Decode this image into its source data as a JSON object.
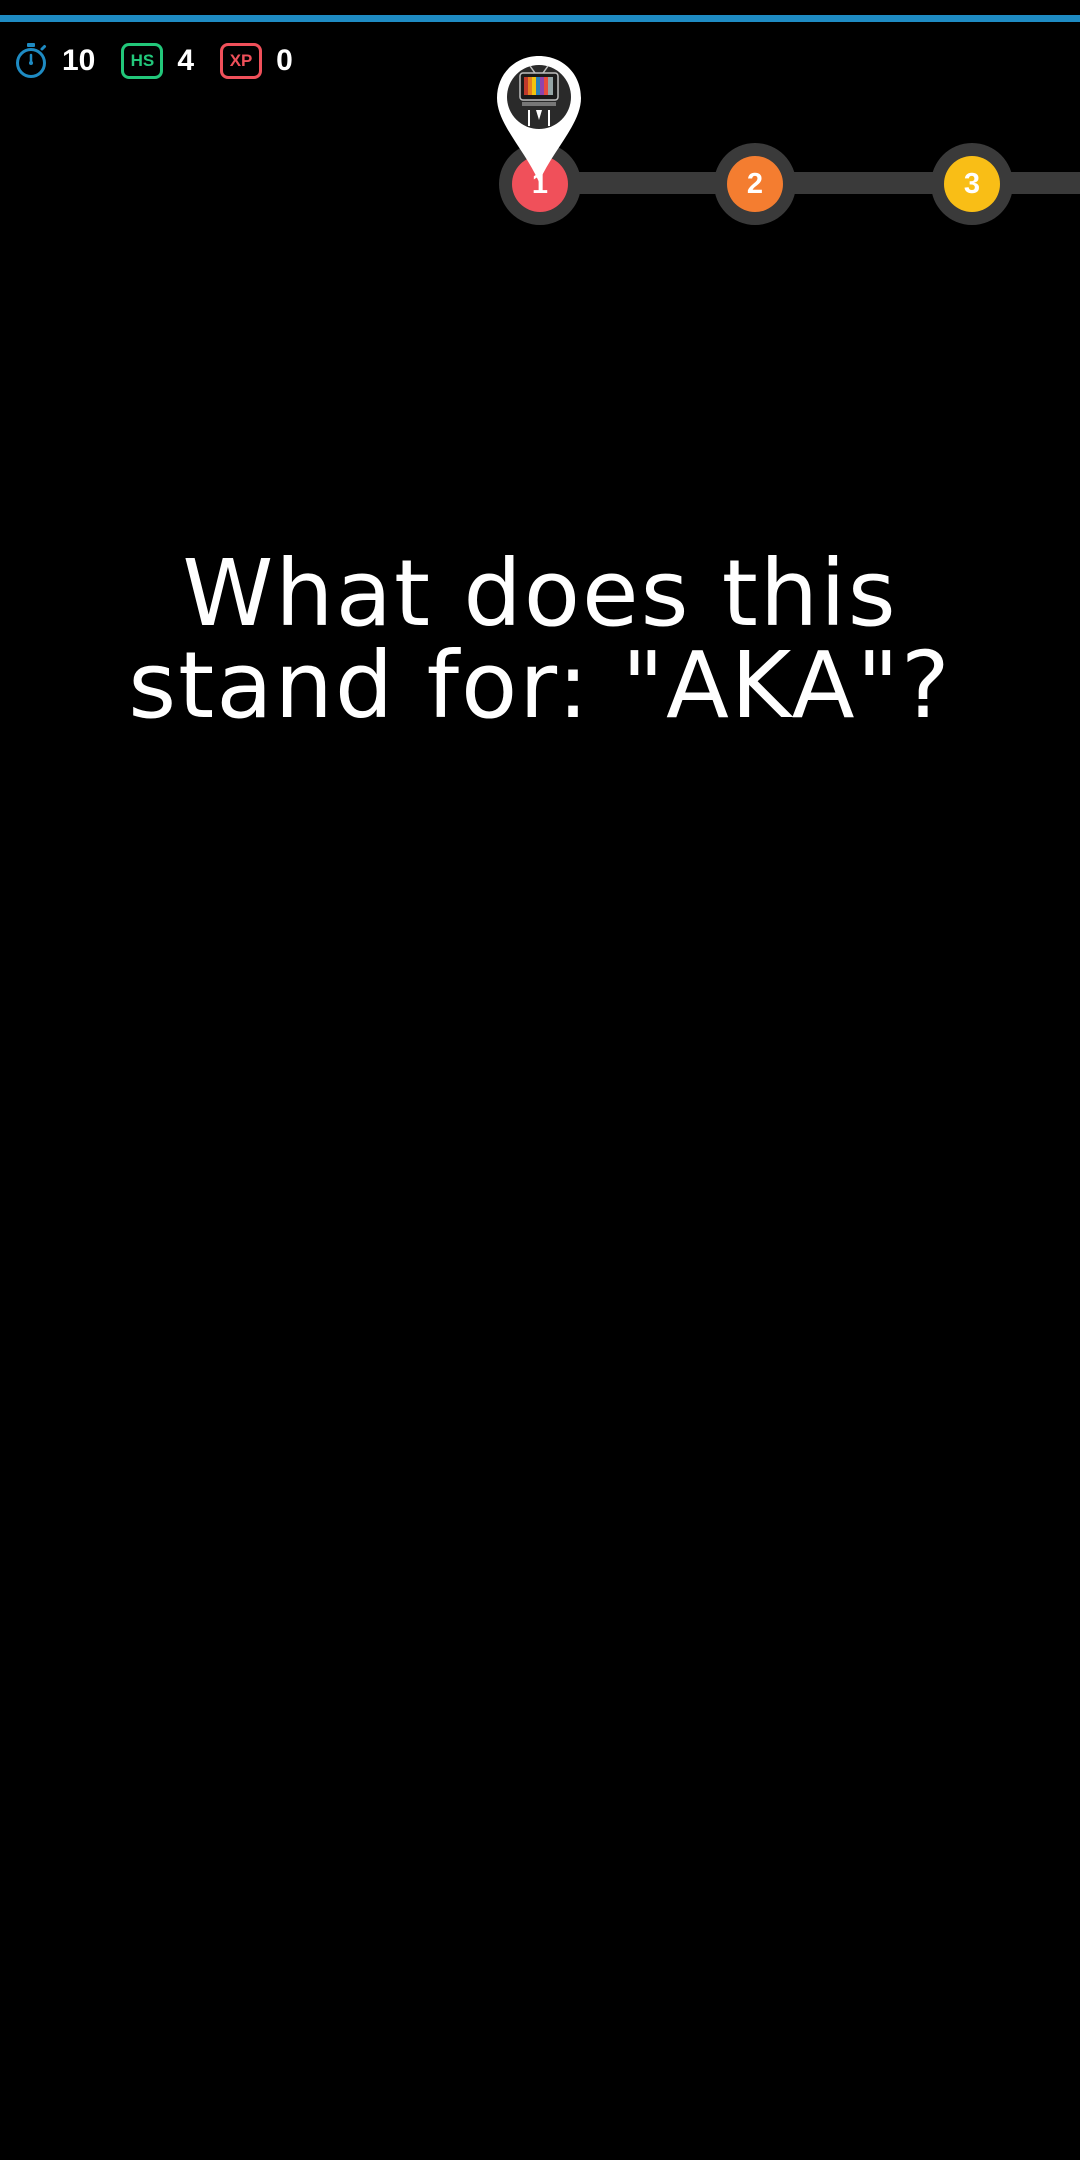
{
  "hud": {
    "timer": {
      "icon": "stopwatch-icon",
      "value": "10"
    },
    "high_score": {
      "badge": "HS",
      "value": "4"
    },
    "xp": {
      "badge": "XP",
      "value": "0"
    }
  },
  "progress_track": {
    "current_level": 1,
    "levels": [
      {
        "label": "1",
        "color": "#f0505a"
      },
      {
        "label": "2",
        "color": "#f47d30"
      },
      {
        "label": "3",
        "color": "#f9be16"
      }
    ],
    "marker": {
      "icon": "tv-avatar-pin-icon"
    }
  },
  "question": {
    "text": "What does this stand for: \"AKA\"?"
  },
  "colors": {
    "background": "#000000",
    "timer_bar": "#1e8bc3",
    "hs_badge": "#22c77a",
    "xp_badge": "#f0505a",
    "track": "#3a3a3a"
  }
}
